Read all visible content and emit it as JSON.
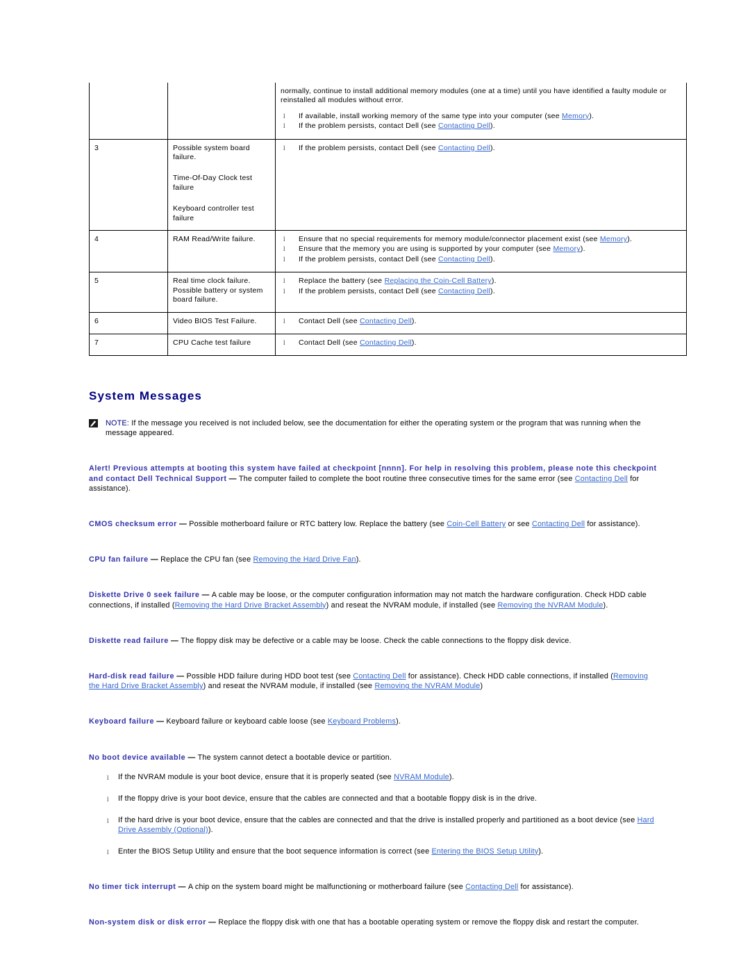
{
  "document": {
    "section_title": "System Messages",
    "note": {
      "icon": "note-pencil-icon",
      "label": "NOTE:",
      "text": " If the message you received is not included below, see the documentation for either the operating system or the program that was running when the message appeared."
    }
  },
  "colors": {
    "heading": "#000080",
    "term": "#3333aa",
    "link": "#3366cc",
    "border": "#000000"
  },
  "beep_table": {
    "rows": [
      {
        "code": "",
        "cause": "",
        "continued": true,
        "action_paragraph": "normally, continue to install additional memory modules (one at a time) until you have identified a faulty module or reinstalled all modules without error.",
        "action_items": [
          {
            "pre": "If available, install working memory of the same type into your computer (see ",
            "link": "Memory",
            "post": ")."
          },
          {
            "pre": "If the problem persists, contact Dell (see ",
            "link": "Contacting Dell",
            "post": ")."
          }
        ]
      },
      {
        "code": "3",
        "cause_lines": [
          "Possible system board failure.",
          "Time-Of-Day Clock test failure",
          "Keyboard controller test failure"
        ],
        "action_paragraph": "",
        "action_items": [
          {
            "pre": "If the problem persists, contact Dell (see ",
            "link": "Contacting Dell",
            "post": ")."
          }
        ]
      },
      {
        "code": "4",
        "cause_lines": [
          "RAM Read/Write failure."
        ],
        "action_paragraph": "",
        "action_items": [
          {
            "pre": "Ensure that no special requirements for memory module/connector placement exist (see ",
            "link": "Memory",
            "post": ")."
          },
          {
            "pre": "Ensure that the memory you are using is supported by your computer (see ",
            "link": "Memory",
            "post": ")."
          },
          {
            "pre": "If the problem persists, contact Dell (see ",
            "link": "Contacting Dell",
            "post": ")."
          }
        ]
      },
      {
        "code": "5",
        "cause_lines": [
          "Real time clock failure. Possible battery or system board failure."
        ],
        "action_paragraph": "",
        "action_items": [
          {
            "pre": "Replace the battery (see ",
            "link": "Replacing the Coin-Cell Battery",
            "post": ")."
          },
          {
            "pre": "If the problem persists, contact Dell (see ",
            "link": "Contacting Dell",
            "post": ")."
          }
        ]
      },
      {
        "code": "6",
        "cause_lines": [
          "Video BIOS Test Failure."
        ],
        "action_paragraph": "",
        "action_items": [
          {
            "pre": "Contact Dell (see ",
            "link": "Contacting Dell",
            "post": ")."
          }
        ]
      },
      {
        "code": "7",
        "cause_lines": [
          "CPU Cache test failure"
        ],
        "action_paragraph": "",
        "action_items": [
          {
            "pre": "Contact Dell (see ",
            "link": "Contacting Dell",
            "post": ")."
          }
        ]
      }
    ]
  },
  "messages": [
    {
      "term": "Alert! Previous attempts at booting this system have failed at checkpoint [nnnn]. For help in resolving this problem, please note this checkpoint and contact Dell Technical Support",
      "dash": " — ",
      "segments": [
        {
          "text": "The computer failed to complete the boot routine three consecutive times for the same error (see "
        },
        {
          "link": "Contacting Dell"
        },
        {
          "text": " for assistance)."
        }
      ]
    },
    {
      "term": "CMOS checksum error",
      "dash": " — ",
      "segments": [
        {
          "text": "Possible motherboard failure or RTC battery low. Replace the battery (see "
        },
        {
          "link": "Coin-Cell Battery"
        },
        {
          "text": " or see "
        },
        {
          "link": "Contacting Dell"
        },
        {
          "text": " for assistance)."
        }
      ]
    },
    {
      "term": "CPU fan failure",
      "dash": " — ",
      "segments": [
        {
          "text": "Replace the CPU fan (see "
        },
        {
          "link": "Removing the Hard Drive Fan"
        },
        {
          "text": ")."
        }
      ]
    },
    {
      "term": "Diskette Drive 0 seek failure",
      "dash": " — ",
      "segments": [
        {
          "text": "A cable may be loose, or the computer configuration information may not match the hardware configuration. Check HDD cable connections, if installed ("
        },
        {
          "link": "Removing the Hard Drive Bracket Assembly"
        },
        {
          "text": ") and reseat the NVRAM module, if installed (see "
        },
        {
          "link": "Removing the NVRAM Module"
        },
        {
          "text": ")."
        }
      ]
    },
    {
      "term": "Diskette read failure",
      "dash": " — ",
      "segments": [
        {
          "text": "The floppy disk may be defective or a cable may be loose. Check the cable connections to the floppy disk device."
        }
      ]
    },
    {
      "term": "Hard-disk read failure",
      "dash": " — ",
      "segments": [
        {
          "text": "Possible HDD failure during HDD boot test (see "
        },
        {
          "link": "Contacting Dell"
        },
        {
          "text": " for assistance). Check HDD cable connections, if installed ("
        },
        {
          "link": "Removing the Hard Drive Bracket Assembly"
        },
        {
          "text": ") and reseat the NVRAM module, if installed (see "
        },
        {
          "link": "Removing the NVRAM Module"
        },
        {
          "text": ")"
        }
      ]
    },
    {
      "term": "Keyboard failure",
      "dash": " — ",
      "segments": [
        {
          "text": "Keyboard failure or keyboard cable loose (see "
        },
        {
          "link": "Keyboard Problems"
        },
        {
          "text": ")."
        }
      ]
    },
    {
      "term": "No boot device available",
      "dash": " — ",
      "segments": [
        {
          "text": "The system cannot detect a bootable device or partition."
        }
      ],
      "list": [
        [
          {
            "text": "If the NVRAM module is your boot device, ensure that it is properly seated (see "
          },
          {
            "link": "NVRAM Module"
          },
          {
            "text": ")."
          }
        ],
        [
          {
            "text": "If the floppy drive is your boot device, ensure that the cables are connected and that a bootable floppy disk is in the drive."
          }
        ],
        [
          {
            "text": "If the hard drive is your boot device, ensure that the cables are connected and that the drive is installed properly and partitioned as a boot device (see "
          },
          {
            "link": "Hard Drive Assembly (Optional)"
          },
          {
            "text": ")."
          }
        ],
        [
          {
            "text": "Enter the BIOS Setup Utility and ensure that the boot sequence information is correct (see "
          },
          {
            "link": "Entering the BIOS Setup Utility"
          },
          {
            "text": ")."
          }
        ]
      ]
    },
    {
      "term": "No timer tick interrupt",
      "dash": " — ",
      "segments": [
        {
          "text": "A chip on the system board might be malfunctioning or motherboard failure (see "
        },
        {
          "link": "Contacting Dell"
        },
        {
          "text": " for assistance)."
        }
      ]
    },
    {
      "term": "Non-system disk or disk error",
      "dash": " — ",
      "segments": [
        {
          "text": "Replace the floppy disk with one that has a bootable operating system or remove the floppy disk and restart the computer."
        }
      ]
    }
  ]
}
